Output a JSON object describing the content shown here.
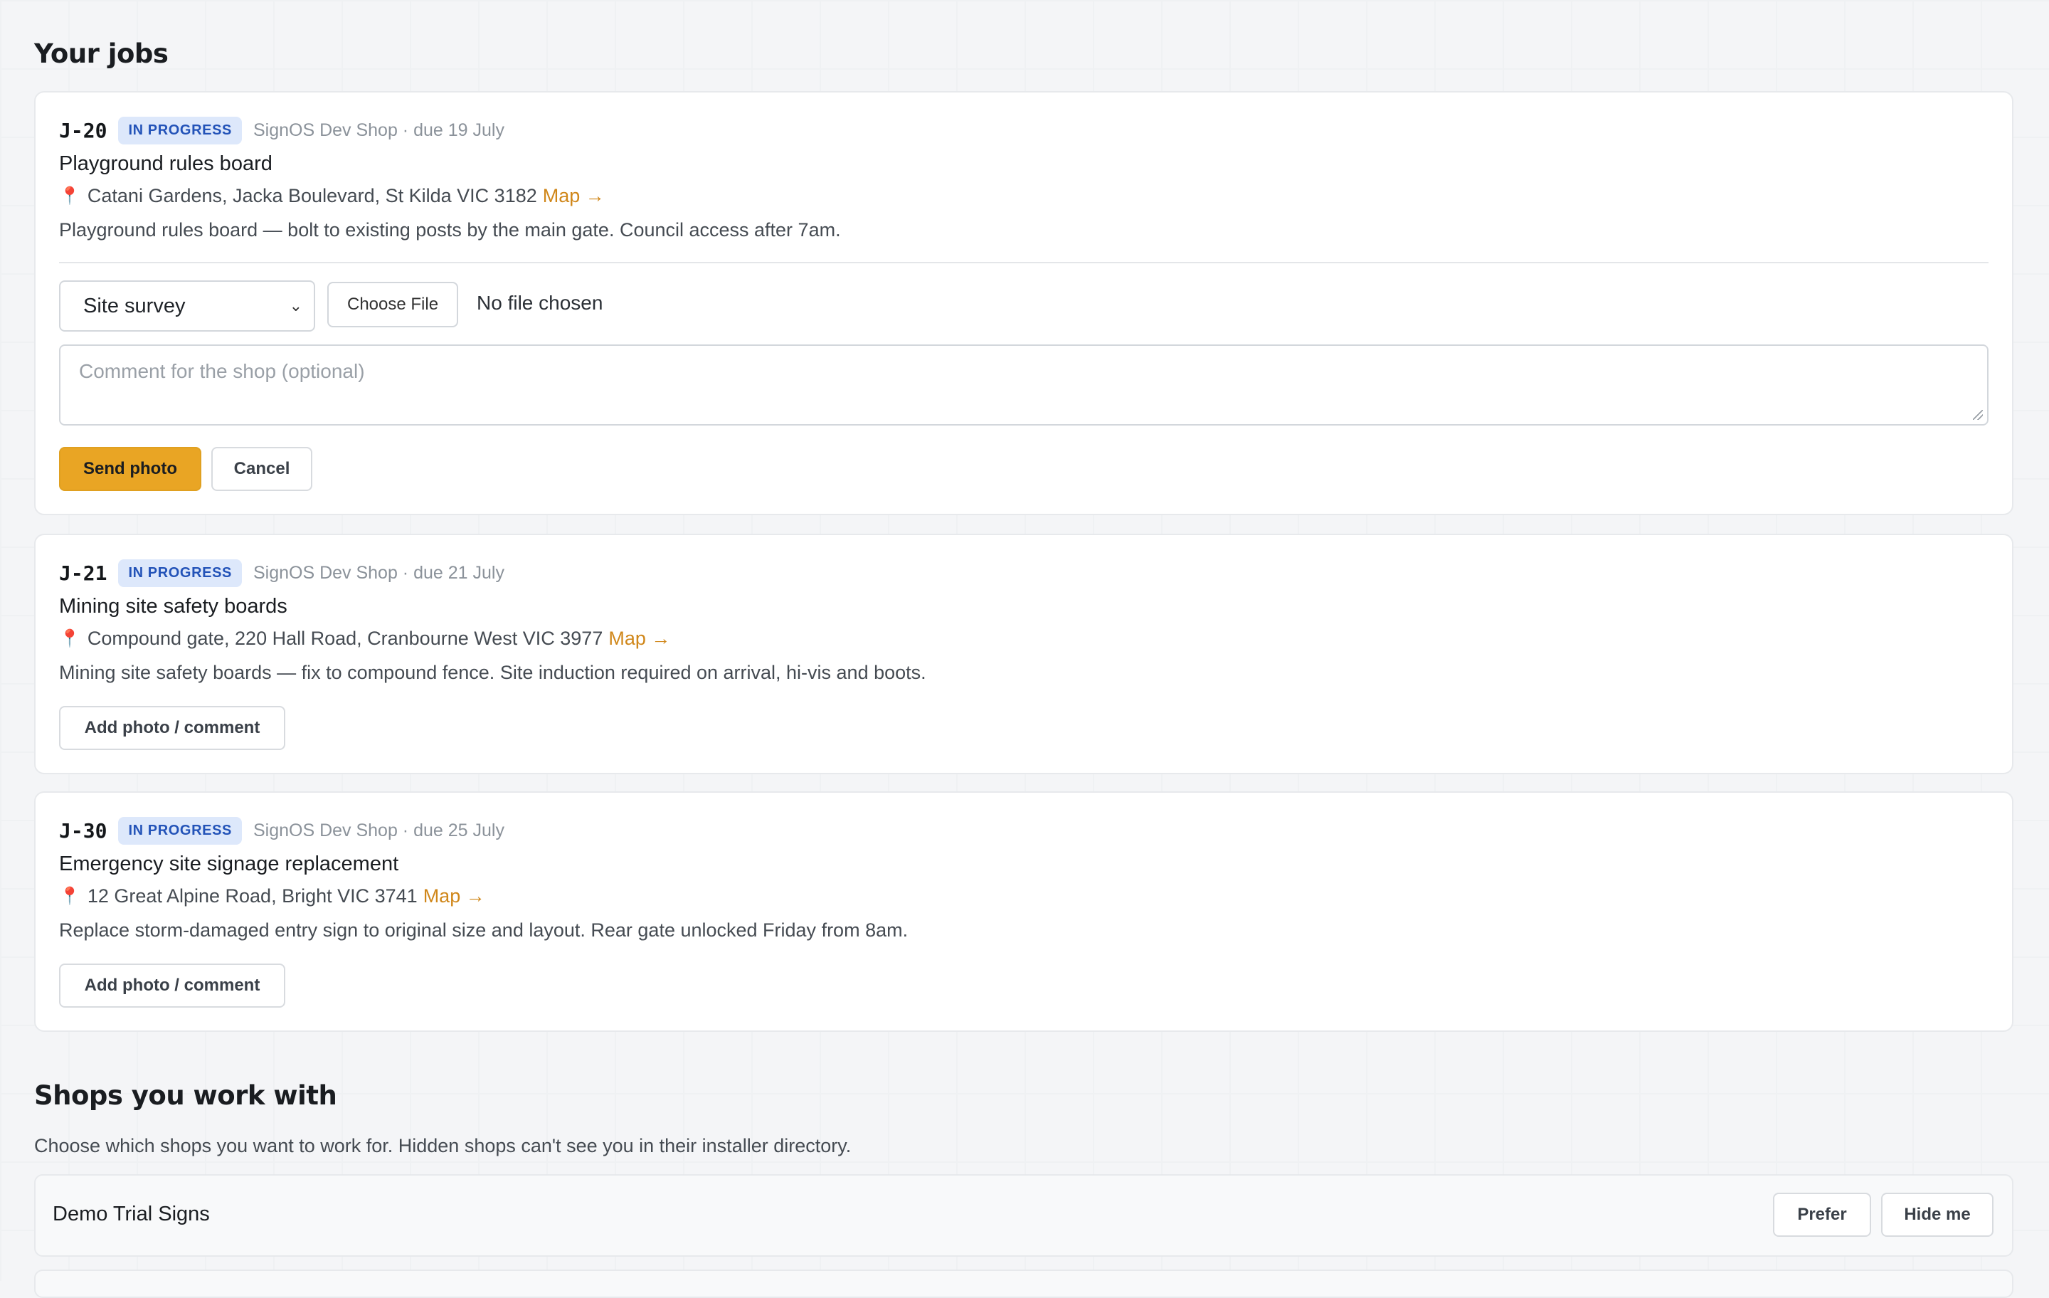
{
  "jobs_section": {
    "title": "Your jobs"
  },
  "jobs": [
    {
      "id": "J-20",
      "status": "IN PROGRESS",
      "meta": "SignOS Dev Shop · due 19 July",
      "title": "Playground rules board",
      "address": "Catani Gardens, Jacka Boulevard, St Kilda VIC 3182",
      "map_label": "Map →",
      "description": "Playground rules board — bolt to existing posts by the main gate. Council access after 7am.",
      "form": {
        "photo_type": "Site survey",
        "file_button": "Choose File",
        "file_status": "No file chosen",
        "comment_placeholder": "Comment for the shop (optional)",
        "send_label": "Send photo",
        "cancel_label": "Cancel"
      }
    },
    {
      "id": "J-21",
      "status": "IN PROGRESS",
      "meta": "SignOS Dev Shop · due 21 July",
      "title": "Mining site safety boards",
      "address": "Compound gate, 220 Hall Road, Cranbourne West VIC 3977",
      "map_label": "Map →",
      "description": "Mining site safety boards — fix to compound fence. Site induction required on arrival, hi-vis and boots.",
      "action_label": "Add photo / comment"
    },
    {
      "id": "J-30",
      "status": "IN PROGRESS",
      "meta": "SignOS Dev Shop · due 25 July",
      "title": "Emergency site signage replacement",
      "address": "12 Great Alpine Road, Bright VIC 3741",
      "map_label": "Map →",
      "description": "Replace storm-damaged entry sign to original size and layout. Rear gate unlocked Friday from 8am.",
      "action_label": "Add photo / comment"
    }
  ],
  "shops_section": {
    "title": "Shops you work with",
    "subtitle": "Choose which shops you want to work for. Hidden shops can't see you in their installer directory.",
    "shops": [
      {
        "name": "Demo Trial Signs",
        "prefer_label": "Prefer",
        "hide_label": "Hide me"
      }
    ]
  },
  "colors": {
    "accent": "#e9a524",
    "badge_bg": "#dde8fb",
    "badge_text": "#2353b8",
    "map_link": "#d0871a"
  }
}
